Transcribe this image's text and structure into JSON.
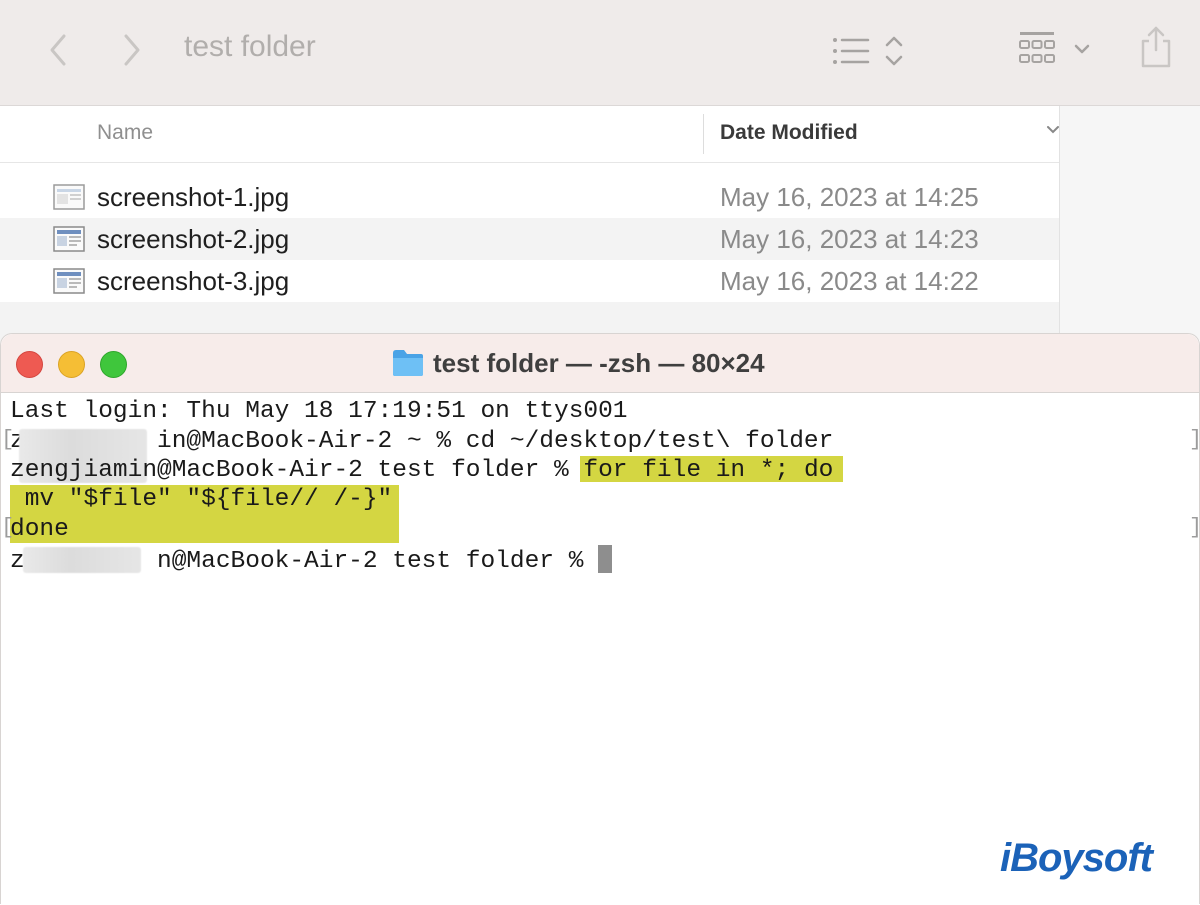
{
  "finder": {
    "title": "test folder",
    "icons": {
      "back": "chevron-left-icon",
      "forward": "chevron-right-icon",
      "list_view": "list-view-icon",
      "sort": "sort-arrows-icon",
      "group": "grid-group-icon",
      "share": "share-icon"
    },
    "columns": {
      "name": "Name",
      "date_modified": "Date Modified"
    },
    "files": [
      {
        "name": "screenshot-1.jpg",
        "date": "May 16, 2023 at 14:25"
      },
      {
        "name": "screenshot-2.jpg",
        "date": "May 16, 2023 at 14:23"
      },
      {
        "name": "screenshot-3.jpg",
        "date": "May 16, 2023 at 14:22"
      }
    ]
  },
  "terminal": {
    "title": "test folder — -zsh — 80×24",
    "lines": {
      "l1": "Last login: Thu May 18 17:19:51 on ttys001",
      "l2": "z         in@MacBook-Air-2 ~ % cd ~/desktop/test\\ folder",
      "l3_prompt": "zengjiamin@MacBook-Air-2 test folder % ",
      "l3_cmd": "for file in *; do",
      "l4": " mv \"$file\" \"${file// /-}\"",
      "l5": "done",
      "l6_prompt": "z         n@MacBook-Air-2 test folder % "
    },
    "highlight_color": "#d4d642"
  },
  "brand": {
    "text": "iBoysoft",
    "color": "#1b62b8"
  }
}
